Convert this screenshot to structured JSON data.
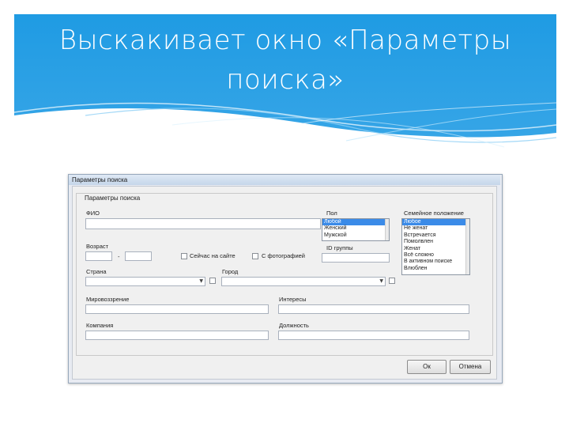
{
  "slide": {
    "title_line1": "Выскакивает окно «Параметры",
    "title_line2": "поиска»"
  },
  "colors": {
    "banner_top": "#1f9be3",
    "banner_bottom": "#3aa7e7",
    "selection": "#3b8be8"
  },
  "dialog": {
    "window_title": "Параметры поиска",
    "group_title": "Параметры поиска",
    "fio_label": "ФИО",
    "age_label": "Возраст",
    "age_separator": "-",
    "online_label": "Сейчас на сайте",
    "photo_label": "С фотографией",
    "sex_label": "Пол",
    "sex_options": [
      "Любой",
      "Женский",
      "Мужской"
    ],
    "sex_selected": "Любой",
    "group_id_label": "ID группы",
    "marital_label": "Семейное положение",
    "marital_options": [
      "Любое",
      "Не женат",
      "Встречается",
      "Помолвлен",
      "Женат",
      "Всё сложно",
      "В активном поиске",
      "Влюблен"
    ],
    "marital_selected": "Любое",
    "country_label": "Страна",
    "city_label": "Город",
    "worldview_label": "Мировоззрение",
    "interests_label": "Интересы",
    "company_label": "Компания",
    "position_label": "Должность",
    "ok_label": "Ок",
    "cancel_label": "Отмена"
  }
}
